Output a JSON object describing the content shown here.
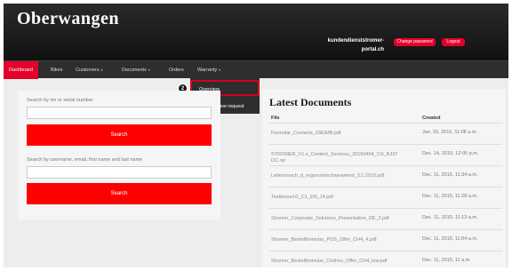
{
  "header": {
    "brand": "Oberwangen",
    "user_line1": "kundendienststromer-",
    "user_line2": "portal.ch",
    "change_password_label": "Change password",
    "logout_label": "Logout"
  },
  "nav": {
    "items": [
      {
        "label": "Dashboard",
        "active": true
      },
      {
        "label": "Bikes"
      },
      {
        "label": "Customers",
        "caret": "▾"
      },
      {
        "label": "Documents",
        "caret": "▾"
      },
      {
        "label": "Orders"
      },
      {
        "label": "Warranty",
        "caret": "▾"
      }
    ]
  },
  "dropdown": {
    "step_badge": "2",
    "items": [
      "Overview",
      "Create a new request"
    ]
  },
  "search": {
    "vin_label": "Search by vin or serial number",
    "vin_value": "",
    "vin_button": "Search",
    "user_label": "Search by username, email, first name and last name",
    "user_value": "",
    "user_button": "Search"
  },
  "documents": {
    "title": "Latest Documents",
    "col_file": "File",
    "col_created": "Created",
    "rows": [
      {
        "file": "Formular_Contacts_03EIMB.pdf",
        "created": "Jan. 20, 2016, 11:08 a.m."
      },
      {
        "file": "STROMER_V1.x_Content_Services_20160404_CH_RJ37 DC.rar",
        "created": "Dec. 14, 2015, 12:05 p.m."
      },
      {
        "file": "Leitervorsch_d_ergonomischweswend_3.1.2015.pdf",
        "created": "Dec. 11, 2015, 11:34 a.m."
      },
      {
        "file": "Testbesuch1_C1_EN_14.pdf",
        "created": "Dec. 11, 2015, 11:28 a.m."
      },
      {
        "file": "Stromer_Corporate_Solutions_Presentation_DE_2.pdf",
        "created": "Dec. 11, 2015, 11:13 a.m."
      },
      {
        "file": "Stromer_Bestellformular_POS_Offer_CH4_4.pdf",
        "created": "Dec. 11, 2015, 11:04 a.m."
      },
      {
        "file": "Stromer_Bestellformular_Clothes_Offer_CH4_low.pdf",
        "created": "Dec. 11, 2015, 11 a.m."
      }
    ]
  },
  "colors": {
    "accent_red": "#ff0000",
    "nav_active": "#e4002b",
    "topbar": "#1a1a1a"
  }
}
